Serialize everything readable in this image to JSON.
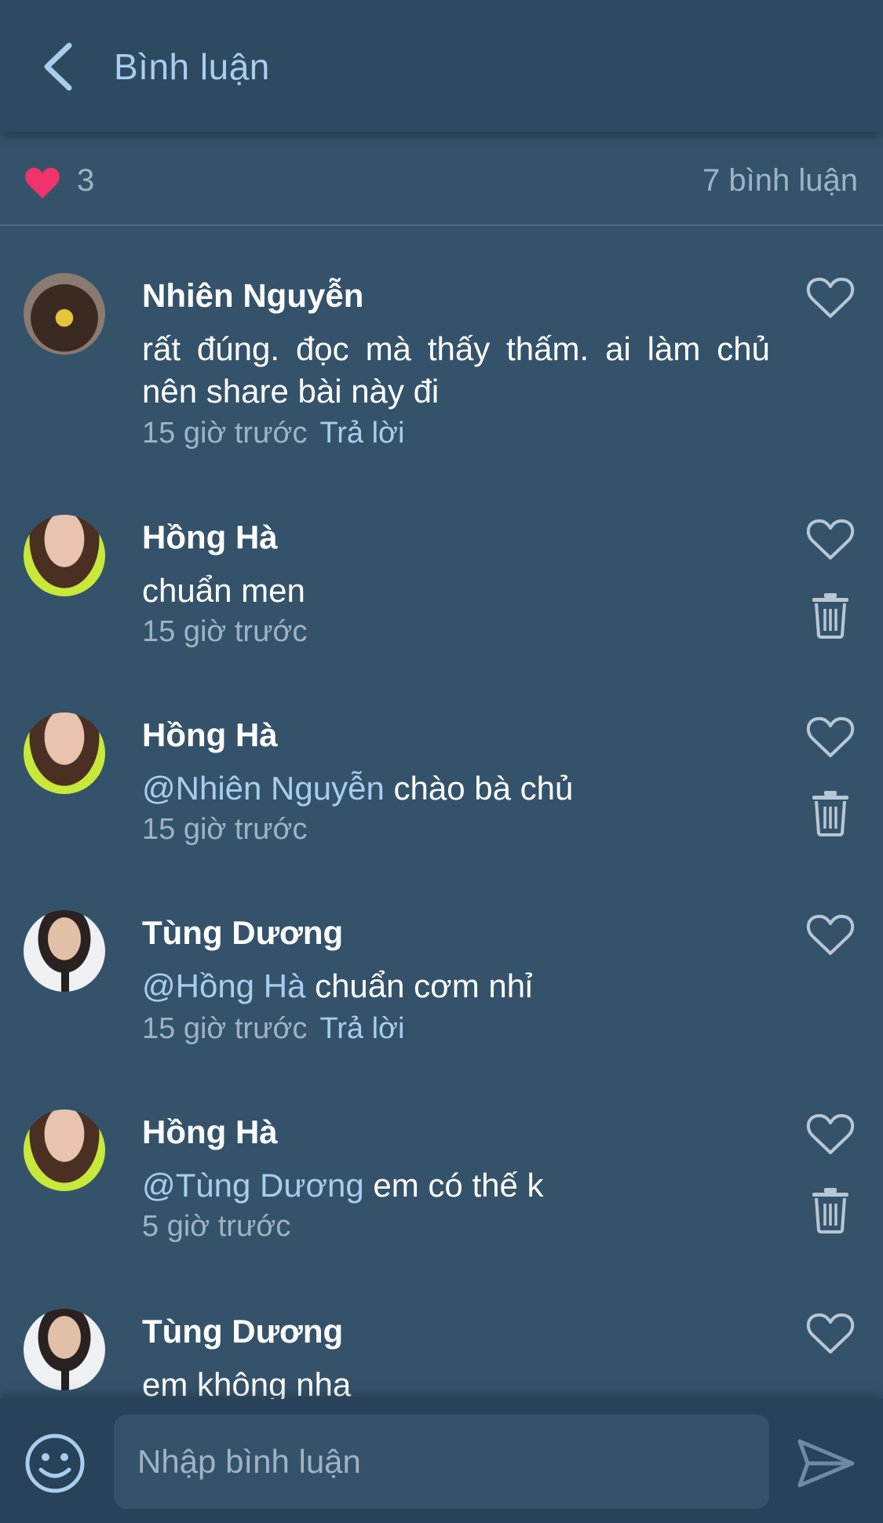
{
  "header": {
    "title": "Bình luận"
  },
  "stats": {
    "likes": "3",
    "comment_count": "7 bình luận"
  },
  "comments": [
    {
      "author": "Nhiên Nguyễn",
      "mention": "",
      "text": "rất đúng. đọc mà thấy thấm. ai làm chủ nên share bài này đi",
      "time": "15 giờ trước",
      "reply": "Trả lời"
    },
    {
      "author": "Hồng Hà",
      "mention": "",
      "text": "chuẩn men",
      "time": "15 giờ trước",
      "reply": ""
    },
    {
      "author": "Hồng Hà",
      "mention": "@Nhiên Nguyễn",
      "text": "chào bà chủ",
      "time": "15 giờ trước",
      "reply": ""
    },
    {
      "author": "Tùng Dương",
      "mention": "@Hồng Hà",
      "text": "chuẩn cơm nhỉ",
      "time": "15 giờ trước",
      "reply": "Trả lời"
    },
    {
      "author": "Hồng Hà",
      "mention": "@Tùng Dương",
      "text": "em có thế k",
      "time": "5 giờ trước",
      "reply": ""
    },
    {
      "author": "Tùng Dương",
      "mention": "",
      "text": "em không nha",
      "time": "",
      "reply": ""
    }
  ],
  "composer": {
    "placeholder": "Nhập bình luận"
  },
  "icons": {
    "back": "chevron-left-icon",
    "like": "heart-filled-icon",
    "comment_like": "heart-outline-icon",
    "delete": "trash-icon",
    "emoji": "smiley-icon",
    "send": "send-icon"
  },
  "colors": {
    "background": "#34536b",
    "header": "#2e4a61",
    "accent": "#a9cdee",
    "heart": "#f0336c",
    "muted": "#9fb3c4"
  }
}
